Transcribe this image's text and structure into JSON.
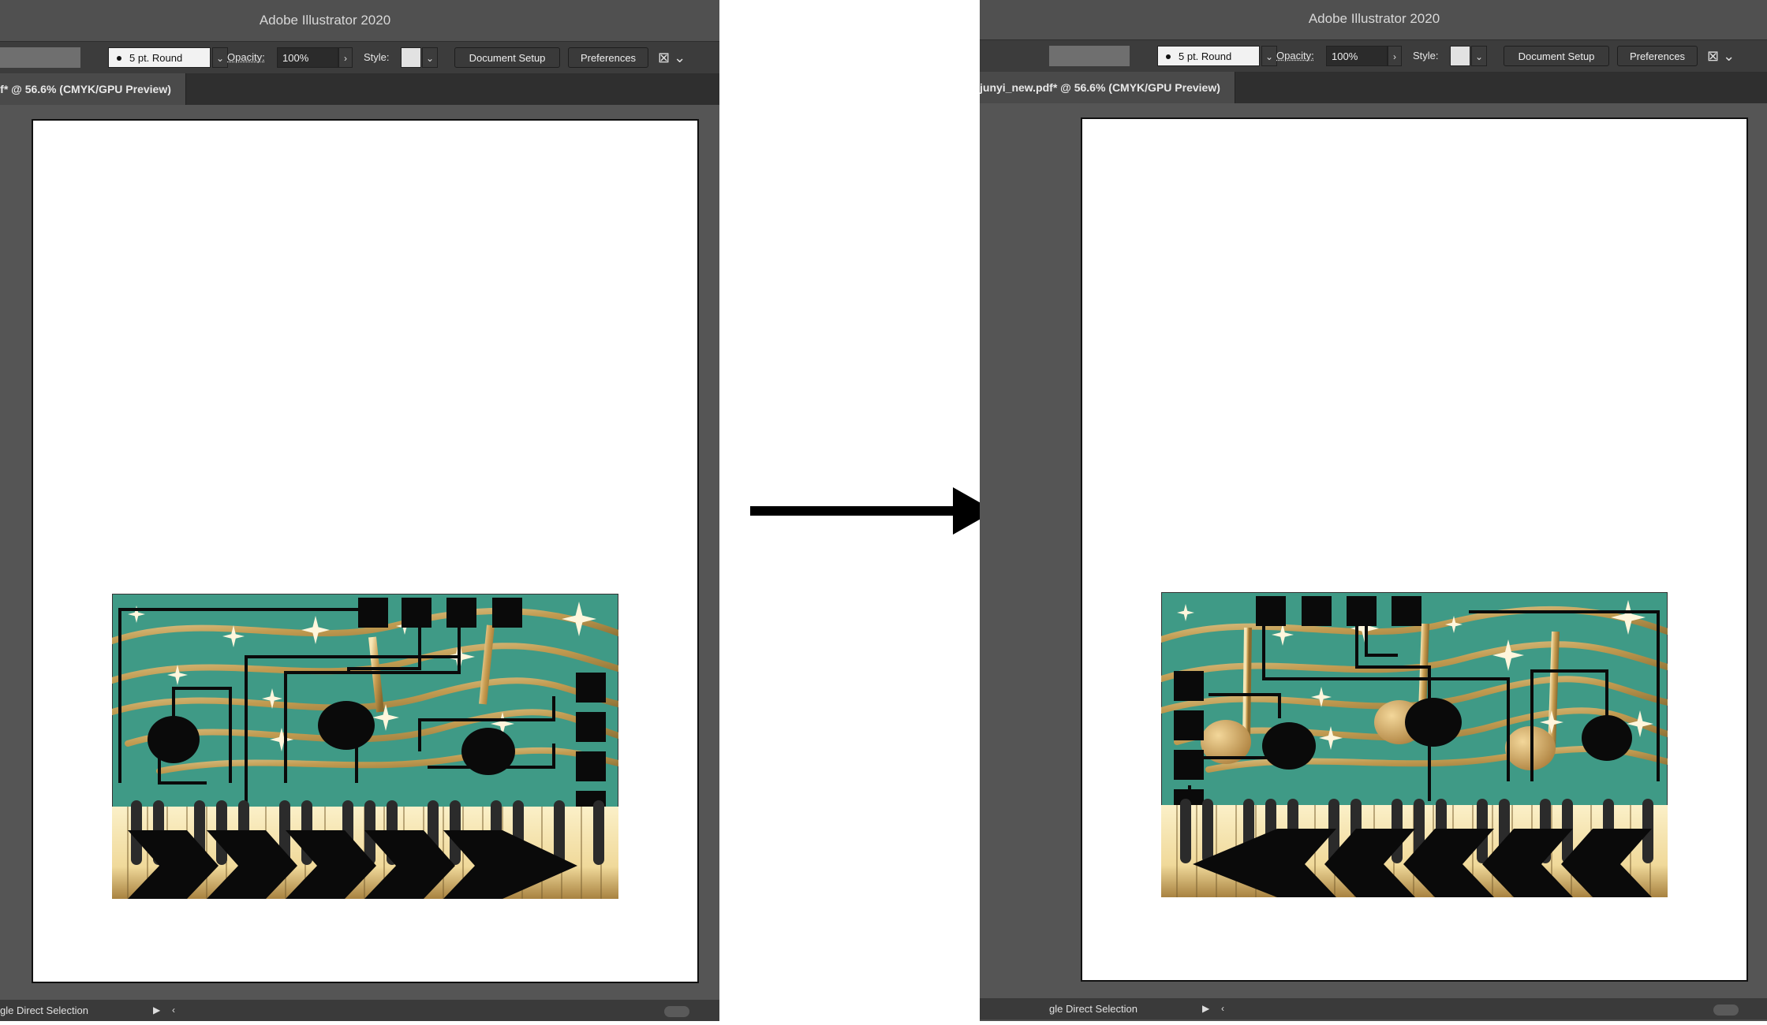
{
  "app_title": "Adobe Illustrator 2020",
  "control_bar": {
    "stroke_label": "5 pt. Round",
    "opacity_label": "Opacity:",
    "opacity_value": "100%",
    "opacity_arrow": "›",
    "style_label": "Style:",
    "dropdown_glyph": "⌄",
    "document_setup": "Document Setup",
    "preferences": "Preferences",
    "arrange_icon": "arrange-icon"
  },
  "document_tab": "junyi_new.pdf* @ 56.6% (CMYK/GPU Preview)",
  "status_bar": {
    "tool_name": "gle Direct Selection",
    "play_glyph": "▶",
    "prev_glyph": "‹"
  },
  "colors": {
    "teal_background": "#3f9a86",
    "gold": "#c9a35a",
    "black_shapes": "#0a0a0a",
    "piano_keys": "#f3dfa8"
  },
  "transition": {
    "arrow_icon": "right-arrow-icon"
  }
}
